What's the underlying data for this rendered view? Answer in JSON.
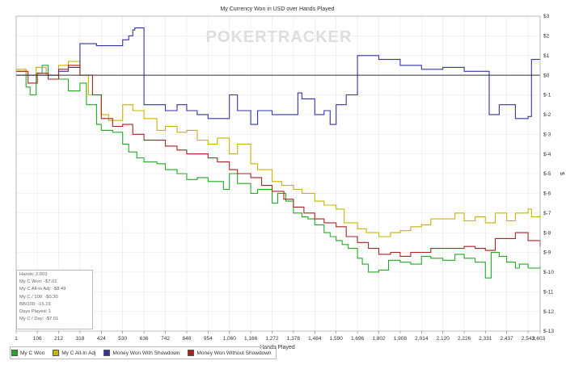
{
  "chart_data": {
    "type": "line",
    "title": "My Currency Won in USD over Hands Played",
    "xlabel": "Hands Played",
    "ylabel": "$",
    "xlim": [
      1,
      2603
    ],
    "ylim": [
      -13,
      3
    ],
    "x_ticks": [
      "1",
      "106",
      "212",
      "318",
      "424",
      "530",
      "636",
      "742",
      "848",
      "954",
      "1,060",
      "1,166",
      "1,272",
      "1,378",
      "1,484",
      "1,590",
      "1,696",
      "1,802",
      "1,908",
      "2,014",
      "2,120",
      "2,226",
      "2,331",
      "2,437",
      "2,543",
      "2,603"
    ],
    "y_ticks": [
      "$3",
      "$2",
      "$1",
      "$0",
      "$-1",
      "$-2",
      "$-3",
      "$-4",
      "$-5",
      "$-6",
      "$-7",
      "$-8",
      "$-9",
      "$-10",
      "$-11",
      "$-12",
      "$-13"
    ],
    "grid": true,
    "legend_position": "bottom-left",
    "watermark": "POKERTRACKER",
    "series": [
      {
        "name": "My C Won",
        "color": "#22aa22",
        "x": [
          1,
          50,
          70,
          100,
          130,
          160,
          212,
          260,
          318,
          350,
          400,
          424,
          480,
          530,
          560,
          600,
          636,
          700,
          742,
          800,
          848,
          900,
          954,
          1000,
          1030,
          1060,
          1100,
          1166,
          1200,
          1272,
          1300,
          1340,
          1378,
          1420,
          1450,
          1484,
          1530,
          1560,
          1590,
          1620,
          1650,
          1696,
          1720,
          1750,
          1802,
          1850,
          1908,
          1960,
          2014,
          2060,
          2120,
          2180,
          2226,
          2280,
          2331,
          2360,
          2400,
          2437,
          2480,
          2500,
          2543,
          2560,
          2603
        ],
        "y": [
          0.2,
          -0.6,
          -1.0,
          0.1,
          0.5,
          0.0,
          -0.2,
          -0.8,
          -0.4,
          -1.5,
          -2.5,
          -2.8,
          -2.9,
          -3.5,
          -3.9,
          -4.2,
          -4.4,
          -4.5,
          -4.8,
          -5.0,
          -5.3,
          -5.2,
          -5.4,
          -5.4,
          -5.8,
          -5.0,
          -5.5,
          -6.0,
          -5.8,
          -6.5,
          -6.0,
          -6.4,
          -7.0,
          -7.2,
          -7.3,
          -7.6,
          -8.0,
          -8.2,
          -8.4,
          -8.6,
          -8.8,
          -9.3,
          -9.6,
          -10.0,
          -9.9,
          -9.4,
          -9.5,
          -9.6,
          -9.2,
          -9.3,
          -9.4,
          -9.1,
          -9.3,
          -9.5,
          -10.3,
          -9.0,
          -9.2,
          -9.5,
          -9.8,
          -9.6,
          -9.8,
          -9.8,
          -9.7
        ]
      },
      {
        "name": "My C All-In Adj",
        "color": "#c8b400",
        "x": [
          1,
          50,
          100,
          150,
          212,
          260,
          318,
          360,
          424,
          460,
          530,
          580,
          636,
          700,
          742,
          800,
          848,
          900,
          954,
          1000,
          1060,
          1100,
          1166,
          1200,
          1272,
          1320,
          1378,
          1420,
          1484,
          1530,
          1590,
          1630,
          1696,
          1740,
          1802,
          1860,
          1908,
          1960,
          2014,
          2060,
          2120,
          2180,
          2226,
          2280,
          2331,
          2380,
          2437,
          2480,
          2543,
          2560,
          2603
        ],
        "y": [
          0.3,
          0.0,
          0.4,
          0.0,
          0.5,
          0.7,
          0.0,
          -1.0,
          -2.0,
          -2.3,
          -1.5,
          -1.8,
          -2.2,
          -2.8,
          -2.6,
          -2.9,
          -2.8,
          -3.3,
          -3.5,
          -3.2,
          -4.0,
          -3.5,
          -4.5,
          -4.8,
          -5.4,
          -5.6,
          -5.8,
          -6.0,
          -6.4,
          -6.6,
          -6.8,
          -7.5,
          -7.8,
          -8.0,
          -8.2,
          -8.0,
          -7.9,
          -7.7,
          -7.6,
          -7.3,
          -7.3,
          -7.0,
          -7.4,
          -7.2,
          -7.5,
          -7.0,
          -7.4,
          -7.0,
          -6.8,
          -7.2,
          -7.1
        ]
      },
      {
        "name": "Money Won With Showdown",
        "color": "#3333aa",
        "x": [
          1,
          106,
          212,
          260,
          318,
          400,
          424,
          530,
          560,
          580,
          590,
          636,
          700,
          742,
          800,
          848,
          900,
          954,
          1060,
          1100,
          1166,
          1200,
          1272,
          1378,
          1400,
          1420,
          1484,
          1530,
          1560,
          1590,
          1640,
          1696,
          1802,
          1908,
          2014,
          2120,
          2226,
          2331,
          2350,
          2400,
          2437,
          2480,
          2543,
          2560,
          2603
        ],
        "y": [
          0,
          0,
          0.2,
          0.4,
          1.6,
          1.5,
          1.5,
          1.8,
          2.0,
          2.3,
          2.4,
          -1.5,
          -1.5,
          -1.8,
          -1.5,
          -1.8,
          -2.0,
          -2.2,
          -1.0,
          -1.8,
          -2.5,
          -1.8,
          -2.0,
          -2.0,
          -0.9,
          -1.2,
          -2.0,
          -1.8,
          -2.5,
          -1.5,
          -1.0,
          1.0,
          0.8,
          0.5,
          0.3,
          0.4,
          0.2,
          0.2,
          -2.0,
          -1.5,
          -1.5,
          -2.2,
          -2.1,
          0.8,
          0.8
        ]
      },
      {
        "name": "Money Won Without Showdown",
        "color": "#aa2222",
        "x": [
          1,
          60,
          106,
          160,
          212,
          260,
          318,
          380,
          424,
          480,
          530,
          580,
          636,
          700,
          742,
          800,
          848,
          900,
          954,
          1000,
          1060,
          1100,
          1166,
          1220,
          1272,
          1330,
          1378,
          1430,
          1484,
          1530,
          1590,
          1640,
          1696,
          1750,
          1802,
          1860,
          1908,
          1960,
          2014,
          2060,
          2120,
          2180,
          2226,
          2280,
          2331,
          2380,
          2437,
          2480,
          2543,
          2603
        ],
        "y": [
          0.2,
          -0.4,
          0.1,
          -0.2,
          0.3,
          0.5,
          0.0,
          -1.0,
          -2.2,
          -2.6,
          -2.5,
          -3.0,
          -3.3,
          -3.3,
          -3.6,
          -3.8,
          -4.0,
          -4.0,
          -4.2,
          -4.4,
          -4.8,
          -5.0,
          -5.2,
          -5.6,
          -5.9,
          -6.3,
          -6.7,
          -7.0,
          -7.3,
          -7.5,
          -7.7,
          -8.2,
          -8.5,
          -8.8,
          -9.1,
          -9.0,
          -9.2,
          -9.0,
          -9.0,
          -8.8,
          -8.8,
          -8.8,
          -8.7,
          -8.8,
          -8.9,
          -8.3,
          -8.3,
          -8.0,
          -8.4,
          -8.7
        ]
      }
    ]
  },
  "stats": {
    "hands": "Hands: 2,603",
    "my_c_won": "My C Won: -$7.01",
    "all_in_adj": "My C All-In Adj: -$8.49",
    "per_100": "My C / 100: -$0.30",
    "bb_100": "BB/100: -15.19",
    "days_played": "Days Played: 1",
    "per_day": "My C / Day: -$7.01"
  }
}
